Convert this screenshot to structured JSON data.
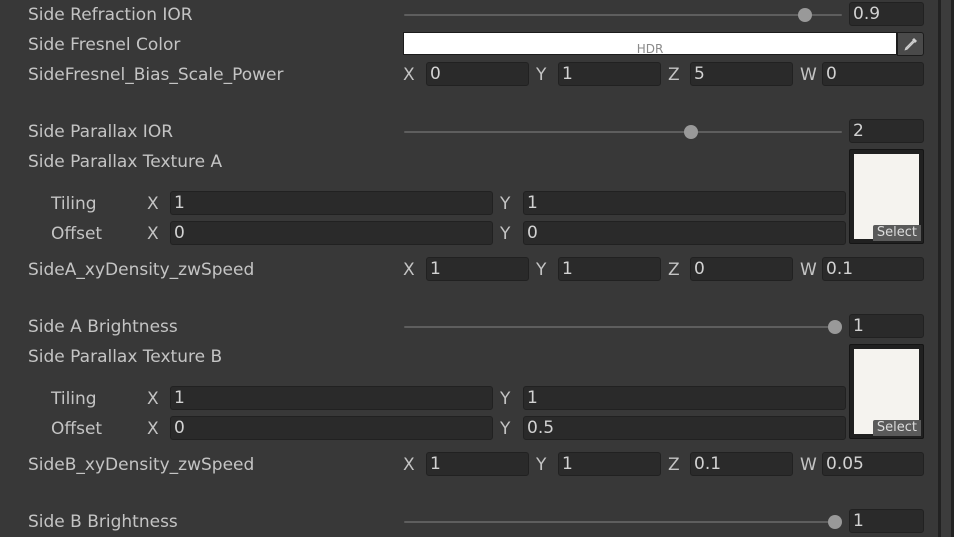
{
  "rows": {
    "side_refraction_ior": {
      "label": "Side Refraction IOR",
      "value": "0.9",
      "slider_fraction": 0.93
    },
    "side_fresnel_color": {
      "label": "Side Fresnel Color",
      "color": "#ffffff",
      "hdr_label": "HDR",
      "picker_icon": "eyedropper-icon"
    },
    "side_fresnel_bias": {
      "label": "SideFresnel_Bias_Scale_Power",
      "x": "0",
      "y": "1",
      "z": "5",
      "w": "0"
    },
    "side_parallax_ior": {
      "label": "Side Parallax IOR",
      "value": "2",
      "slider_fraction": 0.66
    },
    "side_parallax_texture_a": {
      "label": "Side Parallax Texture A",
      "tiling_label": "Tiling",
      "offset_label": "Offset",
      "tiling_x": "1",
      "tiling_y": "1",
      "offset_x": "0",
      "offset_y": "0",
      "select_label": "Select"
    },
    "side_a_density": {
      "label": "SideA_xyDensity_zwSpeed",
      "x": "1",
      "y": "1",
      "z": "0",
      "w": "0.1"
    },
    "side_a_brightness": {
      "label": "Side A Brightness",
      "value": "1",
      "slider_fraction": 1.0
    },
    "side_parallax_texture_b": {
      "label": "Side Parallax Texture B",
      "tiling_label": "Tiling",
      "offset_label": "Offset",
      "tiling_x": "1",
      "tiling_y": "1",
      "offset_x": "0",
      "offset_y": "0.5",
      "select_label": "Select"
    },
    "side_b_density": {
      "label": "SideB_xyDensity_zwSpeed",
      "x": "1",
      "y": "1",
      "z": "0.1",
      "w": "0.05"
    },
    "side_b_brightness": {
      "label": "Side B Brightness",
      "value": "1",
      "slider_fraction": 1.0
    }
  },
  "axis_labels": {
    "x": "X",
    "y": "Y",
    "z": "Z",
    "w": "W"
  },
  "colors": {
    "background": "#383838",
    "field": "#2a2a2a",
    "text": "#c4c4c4"
  }
}
